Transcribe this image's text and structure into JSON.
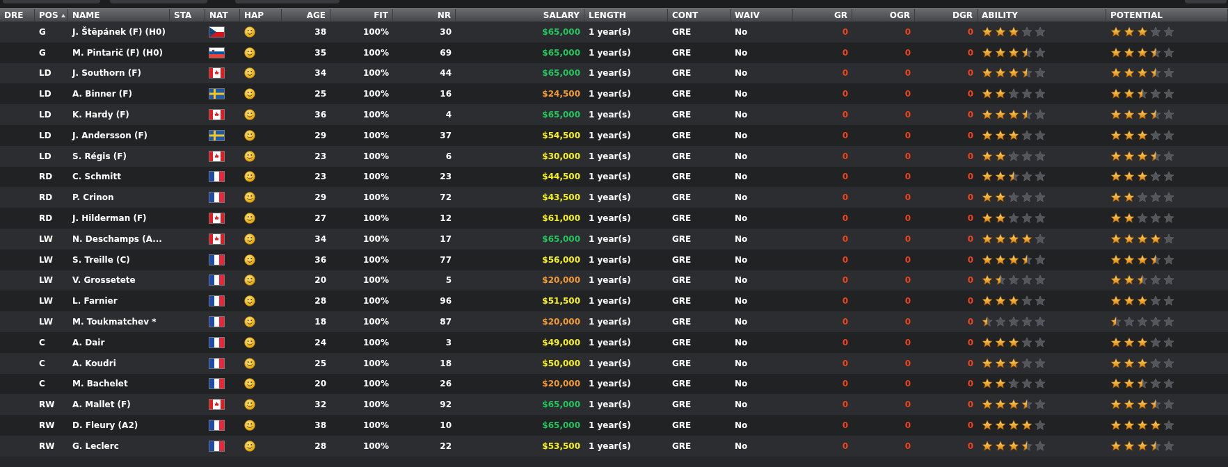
{
  "columns": [
    {
      "label": "DRE",
      "sorted": false
    },
    {
      "label": "POS",
      "sorted": true
    },
    {
      "label": "NAME",
      "sorted": false
    },
    {
      "label": "STA",
      "sorted": false
    },
    {
      "label": "NAT",
      "sorted": false
    },
    {
      "label": "HAP",
      "sorted": false
    },
    {
      "label": "AGE",
      "sorted": false
    },
    {
      "label": "FIT",
      "sorted": false
    },
    {
      "label": "NR",
      "sorted": false
    },
    {
      "label": "SALARY",
      "sorted": false
    },
    {
      "label": "LENGTH",
      "sorted": false
    },
    {
      "label": "CONT",
      "sorted": false
    },
    {
      "label": "WAIV",
      "sorted": false
    },
    {
      "label": "GR",
      "sorted": false
    },
    {
      "label": "OGR",
      "sorted": false
    },
    {
      "label": "DGR",
      "sorted": false
    },
    {
      "label": "ABILITY",
      "sorted": false
    },
    {
      "label": "POTENTIAL",
      "sorted": false
    }
  ],
  "rows": [
    {
      "pos": "G",
      "name": "J. Štěpánek (F) (H0)",
      "nat": {
        "kind": "cz"
      },
      "age": "38",
      "fit": "100%",
      "nr": "30",
      "salary": {
        "text": "$65,000",
        "color": "#22c55e"
      },
      "length": "1 year(s)",
      "cont": "GRE",
      "waiv": "No",
      "gr": "0",
      "ogr": "0",
      "dgr": "0",
      "ability": {
        "stars": 3
      },
      "potential": {
        "stars": 3
      }
    },
    {
      "pos": "G",
      "name": "M. Pintarič (F) (H0)",
      "nat": {
        "kind": "si"
      },
      "age": "35",
      "fit": "100%",
      "nr": "69",
      "salary": {
        "text": "$65,000",
        "color": "#22c55e"
      },
      "length": "1 year(s)",
      "cont": "GRE",
      "waiv": "No",
      "gr": "0",
      "ogr": "0",
      "dgr": "0",
      "ability": {
        "stars": 3.5
      },
      "potential": {
        "stars": 3.5
      }
    },
    {
      "pos": "LD",
      "name": "J. Southorn (F)",
      "nat": {
        "kind": "ca"
      },
      "age": "34",
      "fit": "100%",
      "nr": "44",
      "salary": {
        "text": "$65,000",
        "color": "#22c55e"
      },
      "length": "1 year(s)",
      "cont": "GRE",
      "waiv": "No",
      "gr": "0",
      "ogr": "0",
      "dgr": "0",
      "ability": {
        "stars": 3.5
      },
      "potential": {
        "stars": 3.5
      }
    },
    {
      "pos": "LD",
      "name": "A. Binner (F)",
      "nat": {
        "kind": "se"
      },
      "age": "25",
      "fit": "100%",
      "nr": "16",
      "salary": {
        "text": "$24,500",
        "color": "#f39a33"
      },
      "length": "1 year(s)",
      "cont": "GRE",
      "waiv": "No",
      "gr": "0",
      "ogr": "0",
      "dgr": "0",
      "ability": {
        "stars": 2
      },
      "potential": {
        "stars": 2.5
      }
    },
    {
      "pos": "LD",
      "name": "K. Hardy (F)",
      "nat": {
        "kind": "ca"
      },
      "age": "36",
      "fit": "100%",
      "nr": "4",
      "salary": {
        "text": "$65,000",
        "color": "#22c55e"
      },
      "length": "1 year(s)",
      "cont": "GRE",
      "waiv": "No",
      "gr": "0",
      "ogr": "0",
      "dgr": "0",
      "ability": {
        "stars": 3.5
      },
      "potential": {
        "stars": 3.5
      }
    },
    {
      "pos": "LD",
      "name": "J. Andersson (F)",
      "nat": {
        "kind": "se"
      },
      "age": "29",
      "fit": "100%",
      "nr": "37",
      "salary": {
        "text": "$54,500",
        "color": "#f5f01e"
      },
      "length": "1 year(s)",
      "cont": "GRE",
      "waiv": "No",
      "gr": "0",
      "ogr": "0",
      "dgr": "0",
      "ability": {
        "stars": 3
      },
      "potential": {
        "stars": 3
      }
    },
    {
      "pos": "LD",
      "name": "S. Régis (F)",
      "nat": {
        "kind": "ca"
      },
      "age": "23",
      "fit": "100%",
      "nr": "6",
      "salary": {
        "text": "$30,000",
        "color": "#f5f01e"
      },
      "length": "1 year(s)",
      "cont": "GRE",
      "waiv": "No",
      "gr": "0",
      "ogr": "0",
      "dgr": "0",
      "ability": {
        "stars": 2
      },
      "potential": {
        "stars": 3.5
      }
    },
    {
      "pos": "RD",
      "name": "C. Schmitt",
      "nat": {
        "kind": "fr"
      },
      "age": "23",
      "fit": "100%",
      "nr": "23",
      "salary": {
        "text": "$44,500",
        "color": "#f5f01e"
      },
      "length": "1 year(s)",
      "cont": "GRE",
      "waiv": "No",
      "gr": "0",
      "ogr": "0",
      "dgr": "0",
      "ability": {
        "stars": 2.5
      },
      "potential": {
        "stars": 3
      }
    },
    {
      "pos": "RD",
      "name": "P. Crinon",
      "nat": {
        "kind": "fr"
      },
      "age": "29",
      "fit": "100%",
      "nr": "72",
      "salary": {
        "text": "$43,500",
        "color": "#f5f01e"
      },
      "length": "1 year(s)",
      "cont": "GRE",
      "waiv": "No",
      "gr": "0",
      "ogr": "0",
      "dgr": "0",
      "ability": {
        "stars": 2
      },
      "potential": {
        "stars": 2
      }
    },
    {
      "pos": "RD",
      "name": "J. Hilderman (F)",
      "nat": {
        "kind": "ca"
      },
      "age": "27",
      "fit": "100%",
      "nr": "12",
      "salary": {
        "text": "$61,000",
        "color": "#f5f01e"
      },
      "length": "1 year(s)",
      "cont": "GRE",
      "waiv": "No",
      "gr": "0",
      "ogr": "0",
      "dgr": "0",
      "ability": {
        "stars": 2
      },
      "potential": {
        "stars": 2
      }
    },
    {
      "pos": "LW",
      "name": "N. Deschamps (A...",
      "nat": {
        "kind": "ca"
      },
      "age": "34",
      "fit": "100%",
      "nr": "17",
      "salary": {
        "text": "$65,000",
        "color": "#22c55e"
      },
      "length": "1 year(s)",
      "cont": "GRE",
      "waiv": "No",
      "gr": "0",
      "ogr": "0",
      "dgr": "0",
      "ability": {
        "stars": 4
      },
      "potential": {
        "stars": 4
      }
    },
    {
      "pos": "LW",
      "name": "S. Treille (C)",
      "nat": {
        "kind": "fr"
      },
      "age": "36",
      "fit": "100%",
      "nr": "77",
      "salary": {
        "text": "$56,000",
        "color": "#f5f01e"
      },
      "length": "1 year(s)",
      "cont": "GRE",
      "waiv": "No",
      "gr": "0",
      "ogr": "0",
      "dgr": "0",
      "ability": {
        "stars": 3.5
      },
      "potential": {
        "stars": 3.5
      }
    },
    {
      "pos": "LW",
      "name": "V. Grossetete",
      "nat": {
        "kind": "fr"
      },
      "age": "20",
      "fit": "100%",
      "nr": "5",
      "salary": {
        "text": "$20,000",
        "color": "#f39a33"
      },
      "length": "1 year(s)",
      "cont": "GRE",
      "waiv": "No",
      "gr": "0",
      "ogr": "0",
      "dgr": "0",
      "ability": {
        "stars": 1.5
      },
      "potential": {
        "stars": 2.5
      }
    },
    {
      "pos": "LW",
      "name": "L. Farnier",
      "nat": {
        "kind": "fr"
      },
      "age": "28",
      "fit": "100%",
      "nr": "96",
      "salary": {
        "text": "$51,500",
        "color": "#f5f01e"
      },
      "length": "1 year(s)",
      "cont": "GRE",
      "waiv": "No",
      "gr": "0",
      "ogr": "0",
      "dgr": "0",
      "ability": {
        "stars": 3
      },
      "potential": {
        "stars": 3
      }
    },
    {
      "pos": "LW",
      "name": "M. Toukmatchev *",
      "nat": {
        "kind": "fr"
      },
      "age": "18",
      "fit": "100%",
      "nr": "87",
      "salary": {
        "text": "$20,000",
        "color": "#f39a33"
      },
      "length": "1 year(s)",
      "cont": "GRE",
      "waiv": "No",
      "gr": "0",
      "ogr": "0",
      "dgr": "0",
      "ability": {
        "stars": 0.5
      },
      "potential": {
        "stars": 0.5
      }
    },
    {
      "pos": "C",
      "name": "A. Dair",
      "nat": {
        "kind": "fr"
      },
      "age": "24",
      "fit": "100%",
      "nr": "3",
      "salary": {
        "text": "$49,000",
        "color": "#f5f01e"
      },
      "length": "1 year(s)",
      "cont": "GRE",
      "waiv": "No",
      "gr": "0",
      "ogr": "0",
      "dgr": "0",
      "ability": {
        "stars": 3
      },
      "potential": {
        "stars": 3
      }
    },
    {
      "pos": "C",
      "name": "A. Koudri",
      "nat": {
        "kind": "fr"
      },
      "age": "25",
      "fit": "100%",
      "nr": "18",
      "salary": {
        "text": "$50,000",
        "color": "#f5f01e"
      },
      "length": "1 year(s)",
      "cont": "GRE",
      "waiv": "No",
      "gr": "0",
      "ogr": "0",
      "dgr": "0",
      "ability": {
        "stars": 3
      },
      "potential": {
        "stars": 3
      }
    },
    {
      "pos": "C",
      "name": "M. Bachelet",
      "nat": {
        "kind": "fr"
      },
      "age": "20",
      "fit": "100%",
      "nr": "26",
      "salary": {
        "text": "$20,000",
        "color": "#f39a33"
      },
      "length": "1 year(s)",
      "cont": "GRE",
      "waiv": "No",
      "gr": "0",
      "ogr": "0",
      "dgr": "0",
      "ability": {
        "stars": 2
      },
      "potential": {
        "stars": 2.5
      }
    },
    {
      "pos": "RW",
      "name": "A. Mallet (F)",
      "nat": {
        "kind": "ca"
      },
      "age": "32",
      "fit": "100%",
      "nr": "92",
      "salary": {
        "text": "$65,000",
        "color": "#22c55e"
      },
      "length": "1 year(s)",
      "cont": "GRE",
      "waiv": "No",
      "gr": "0",
      "ogr": "0",
      "dgr": "0",
      "ability": {
        "stars": 3.5
      },
      "potential": {
        "stars": 3.5
      }
    },
    {
      "pos": "RW",
      "name": "D. Fleury (A2)",
      "nat": {
        "kind": "fr"
      },
      "age": "38",
      "fit": "100%",
      "nr": "10",
      "salary": {
        "text": "$65,000",
        "color": "#22c55e"
      },
      "length": "1 year(s)",
      "cont": "GRE",
      "waiv": "No",
      "gr": "0",
      "ogr": "0",
      "dgr": "0",
      "ability": {
        "stars": 4
      },
      "potential": {
        "stars": 4
      }
    },
    {
      "pos": "RW",
      "name": "G. Leclerc",
      "nat": {
        "kind": "fr"
      },
      "age": "28",
      "fit": "100%",
      "nr": "22",
      "salary": {
        "text": "$53,500",
        "color": "#f5f01e"
      },
      "length": "1 year(s)",
      "cont": "GRE",
      "waiv": "No",
      "gr": "0",
      "ogr": "0",
      "dgr": "0",
      "ability": {
        "stars": 3.5
      },
      "potential": {
        "stars": 3.5
      }
    }
  ]
}
